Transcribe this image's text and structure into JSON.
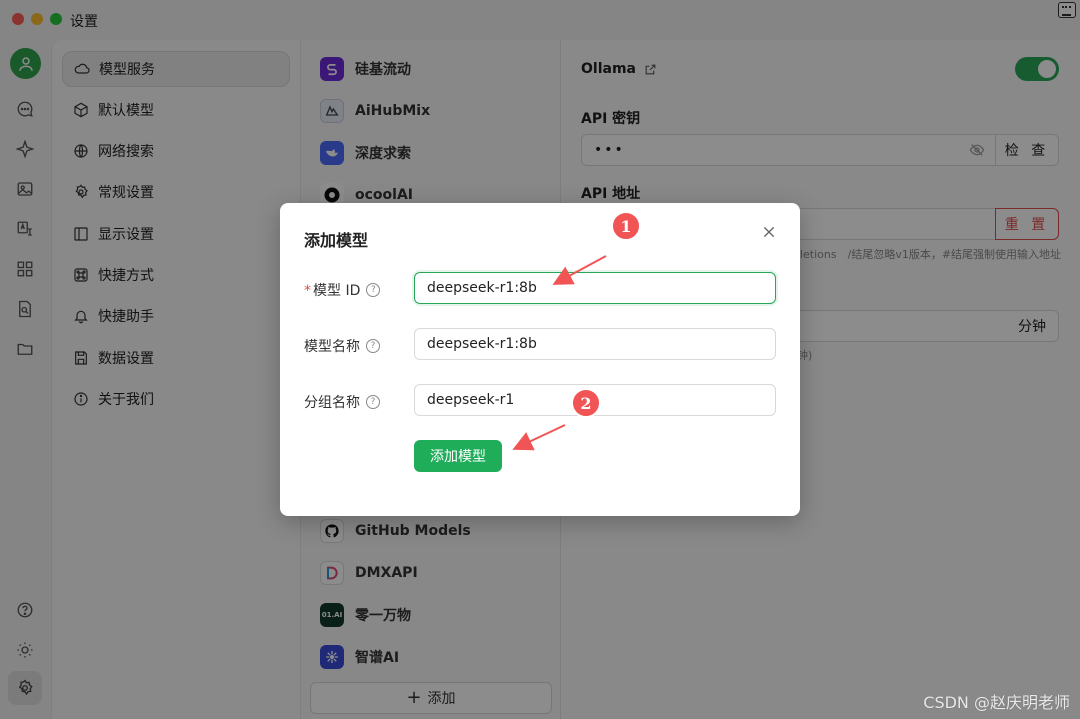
{
  "window": {
    "title": "设置"
  },
  "nav": {
    "items": [
      {
        "label": "模型服务",
        "icon": "cloud-icon"
      },
      {
        "label": "默认模型",
        "icon": "cube-icon"
      },
      {
        "label": "网络搜索",
        "icon": "globe-icon"
      },
      {
        "label": "常规设置",
        "icon": "gear-icon"
      },
      {
        "label": "显示设置",
        "icon": "layout-icon"
      },
      {
        "label": "快捷方式",
        "icon": "command-icon"
      },
      {
        "label": "快捷助手",
        "icon": "bell-icon"
      },
      {
        "label": "数据设置",
        "icon": "save-icon"
      },
      {
        "label": "关于我们",
        "icon": "info-icon"
      }
    ]
  },
  "providers": {
    "items": [
      {
        "name": "硅基流动",
        "color": "#6c2bd9"
      },
      {
        "name": "AiHubMix",
        "color": "#e8eef8"
      },
      {
        "name": "深度求索",
        "color": "#4d6bfe"
      },
      {
        "name": "ocoolAI",
        "color": "#111111"
      },
      {
        "name": "GitHub Models",
        "color": "#ffffff"
      },
      {
        "name": "DMXAPI",
        "color": "#ffffff"
      },
      {
        "name": "零一万物",
        "color": "#123a2b",
        "logo_text": "01.AI"
      },
      {
        "name": "智谱AI",
        "color": "#3b4bdb"
      }
    ],
    "add_label": "添加"
  },
  "detail": {
    "provider_name": "Ollama",
    "api_key_label": "API 密钥",
    "api_key_value": "•••",
    "check_label": "检 查",
    "api_url_label": "API 地址",
    "reset_label": "重 置",
    "url_hint": "pletions　/结尾忽略v1版本，#结尾强制使用输入地址",
    "keepalive_unit": "分钟",
    "keepalive_hint": "钟)"
  },
  "modal": {
    "title": "添加模型",
    "model_id_label": "模型 ID",
    "model_id_value": "deepseek-r1:8b",
    "model_name_label": "模型名称",
    "model_name_value": "deepseek-r1:8b",
    "group_label": "分组名称",
    "group_value": "deepseek-r1",
    "submit_label": "添加模型"
  },
  "annotations": {
    "badge1": "1",
    "badge2": "2",
    "color": "#f15454"
  },
  "watermark": "CSDN @赵庆明老师"
}
